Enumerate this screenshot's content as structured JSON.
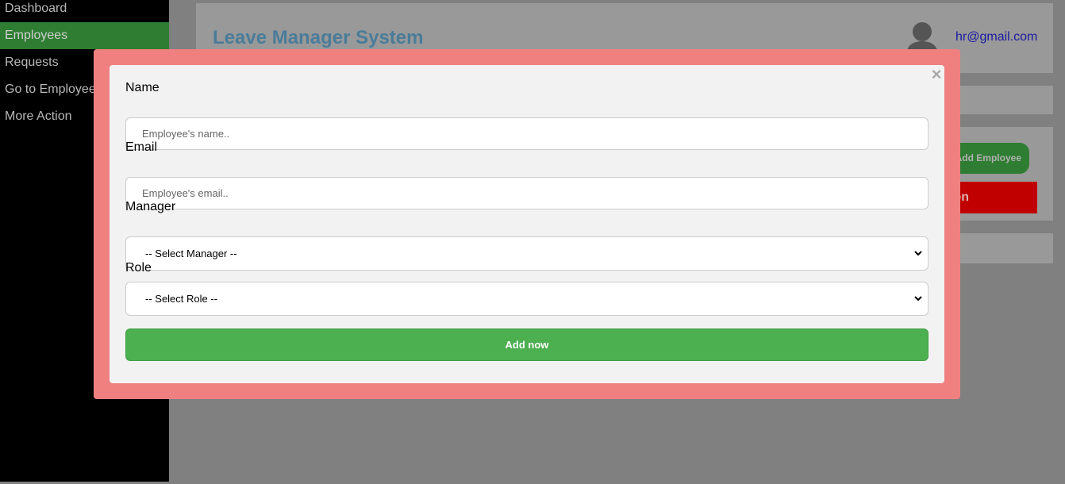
{
  "sidebar": {
    "items": [
      {
        "label": "Dashboard"
      },
      {
        "label": "Employees"
      },
      {
        "label": "Requests"
      },
      {
        "label": "Go to Employee"
      },
      {
        "label": "More Action"
      }
    ],
    "active_index": 1
  },
  "header": {
    "title": "Leave Manager System",
    "user_email": "hr@gmail.com",
    "avatar_icon": "user-avatar-icon"
  },
  "background_actions": {
    "add_employee_label": "Add Employee",
    "red_action_label": "on"
  },
  "modal": {
    "close_symbol": "×",
    "name_label": "Name",
    "name_placeholder": "Employee's name..",
    "email_label": "Email",
    "email_placeholder": "Employee's email..",
    "manager_label": "Manager",
    "manager_selected": "-- Select Manager --",
    "role_label": "Role",
    "role_selected": "-- Select Role --",
    "submit_label": "Add now"
  },
  "colors": {
    "sidebar_bg": "#000000",
    "sidebar_active": "#2e7d32",
    "modal_border": "#f08080",
    "submit_green": "#4caf50",
    "title_blue": "#4a7c99",
    "action_red": "#c00000"
  }
}
